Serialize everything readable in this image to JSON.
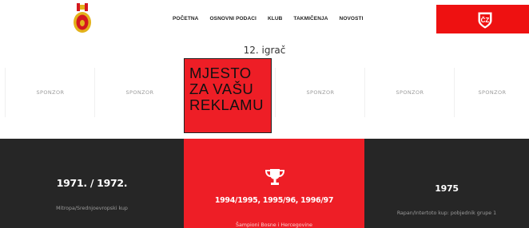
{
  "header": {
    "nav": [
      "POČETNA",
      "OSNOVNI PODACI",
      "KLUB",
      "TAKMIČENJA",
      "NOVOSTI"
    ],
    "cz_logo_text": "ČZ",
    "colors": {
      "accent": "#ee1111",
      "dark": "#262626"
    }
  },
  "subtitle": "12. igrač",
  "sponsors": [
    "SPONZOR",
    "SPONZOR",
    "SPONZOR",
    "SPONZOR",
    "SPONZOR"
  ],
  "ad": {
    "lines": [
      "MJESTO",
      "ZA VAŠU",
      "REKLAMU"
    ]
  },
  "stats": [
    {
      "value": "1971. / 1972.",
      "caption": "Mitropa/Srednjoevropski kup"
    },
    {
      "icon": "trophy-icon",
      "value": "1994/1995, 1995/96, 1996/97",
      "caption": "Šampioni Bosne i Hercegovine"
    },
    {
      "value": "1975",
      "caption": "Rapan/Intertoto kup: pobjednik grupe 1"
    }
  ]
}
